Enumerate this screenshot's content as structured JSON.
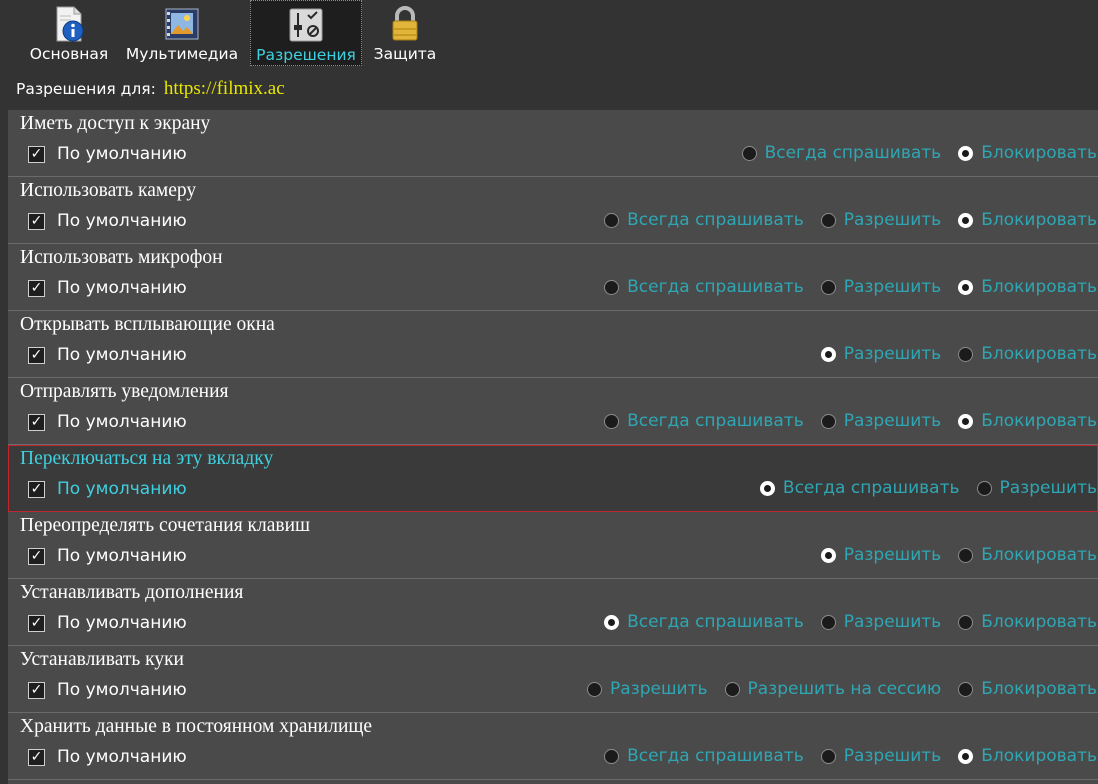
{
  "colors": {
    "background": "#333333",
    "list_background": "#4a4a4a",
    "accent_cyan": "#3fd0df",
    "option_text": "#2fa6b3",
    "url_yellow": "#e7e700",
    "selection_border": "#c0262e"
  },
  "tabs": [
    {
      "label": "Основная",
      "icon": "info-document-icon",
      "active": false
    },
    {
      "label": "Мультимедиа",
      "icon": "film-strip-icon",
      "active": false
    },
    {
      "label": "Разрешения",
      "icon": "permission-sliders-icon",
      "active": true
    },
    {
      "label": "Защита",
      "icon": "padlock-icon",
      "active": false
    }
  ],
  "site": {
    "label": "Разрешения для:",
    "url": "https://filmix.ac"
  },
  "permissions": [
    {
      "title": "Иметь доступ к экрану",
      "default_label": "По умолчанию",
      "default_checked": true,
      "options": [
        {
          "label": "Всегда спрашивать",
          "selected": false
        },
        {
          "label": "Блокировать",
          "selected": true
        }
      ]
    },
    {
      "title": "Использовать камеру",
      "default_label": "По умолчанию",
      "default_checked": true,
      "options": [
        {
          "label": "Всегда спрашивать",
          "selected": false
        },
        {
          "label": "Разрешить",
          "selected": false
        },
        {
          "label": "Блокировать",
          "selected": true
        }
      ]
    },
    {
      "title": "Использовать микрофон",
      "default_label": "По умолчанию",
      "default_checked": true,
      "options": [
        {
          "label": "Всегда спрашивать",
          "selected": false
        },
        {
          "label": "Разрешить",
          "selected": false
        },
        {
          "label": "Блокировать",
          "selected": true
        }
      ]
    },
    {
      "title": "Открывать всплывающие окна",
      "default_label": "По умолчанию",
      "default_checked": true,
      "options": [
        {
          "label": "Разрешить",
          "selected": true
        },
        {
          "label": "Блокировать",
          "selected": false
        }
      ]
    },
    {
      "title": "Отправлять уведомления",
      "default_label": "По умолчанию",
      "default_checked": true,
      "options": [
        {
          "label": "Всегда спрашивать",
          "selected": false
        },
        {
          "label": "Разрешить",
          "selected": false
        },
        {
          "label": "Блокировать",
          "selected": true
        }
      ]
    },
    {
      "title": "Переключаться на эту вкладку",
      "default_label": "По умолчанию",
      "default_checked": true,
      "selected": true,
      "options": [
        {
          "label": "Всегда спрашивать",
          "selected": true
        },
        {
          "label": "Разрешить",
          "selected": false
        }
      ]
    },
    {
      "title": "Переопределять сочетания клавиш",
      "default_label": "По умолчанию",
      "default_checked": true,
      "options": [
        {
          "label": "Разрешить",
          "selected": true
        },
        {
          "label": "Блокировать",
          "selected": false
        }
      ]
    },
    {
      "title": "Устанавливать дополнения",
      "default_label": "По умолчанию",
      "default_checked": true,
      "options": [
        {
          "label": "Всегда спрашивать",
          "selected": true
        },
        {
          "label": "Разрешить",
          "selected": false
        },
        {
          "label": "Блокировать",
          "selected": false
        }
      ]
    },
    {
      "title": "Устанавливать куки",
      "default_label": "По умолчанию",
      "default_checked": true,
      "options": [
        {
          "label": "Разрешить",
          "selected": false
        },
        {
          "label": "Разрешить на сессию",
          "selected": false
        },
        {
          "label": "Блокировать",
          "selected": false
        }
      ]
    },
    {
      "title": "Хранить данные в постоянном хранилище",
      "default_label": "По умолчанию",
      "default_checked": true,
      "options": [
        {
          "label": "Всегда спрашивать",
          "selected": false
        },
        {
          "label": "Разрешить",
          "selected": false
        },
        {
          "label": "Блокировать",
          "selected": true
        }
      ]
    }
  ]
}
